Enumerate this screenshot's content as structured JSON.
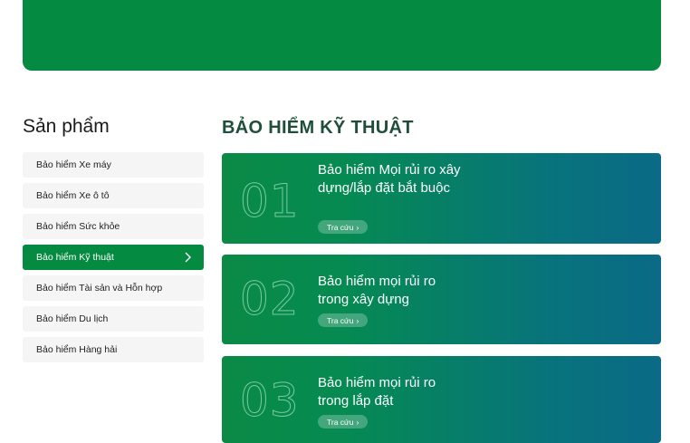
{
  "sidebar": {
    "title": "Sản phẩm",
    "items": [
      {
        "label": "Bảo hiểm Xe máy"
      },
      {
        "label": "Bảo hiểm Xe ô tô"
      },
      {
        "label": "Bảo hiểm Sức khỏe"
      },
      {
        "label": "Bảo hiểm Kỹ thuật",
        "active": true
      },
      {
        "label": "Bảo hiểm Tài sản và Hỗn hợp"
      },
      {
        "label": "Bảo hiểm Du lịch"
      },
      {
        "label": "Bảo hiểm Hàng hải"
      }
    ]
  },
  "main": {
    "title": "BẢO HIỂM KỸ THUẬT",
    "cards": [
      {
        "num": "01",
        "title": "Bảo hiểm Mọi rủi ro xây dựng/lắp đặt bắt buộc",
        "button": "Tra cứu"
      },
      {
        "num": "02",
        "title": "Bảo hiểm mọi rủi ro trong xây dựng",
        "button": "Tra cứu"
      },
      {
        "num": "03",
        "title": "Bảo hiểm mọi rủi ro trong lắp đặt",
        "button": "Tra cứu"
      }
    ]
  },
  "colors": {
    "brand_green": "#058a42",
    "card_gradient_end": "#0b6a86",
    "section_title": "#1f4f3b"
  }
}
